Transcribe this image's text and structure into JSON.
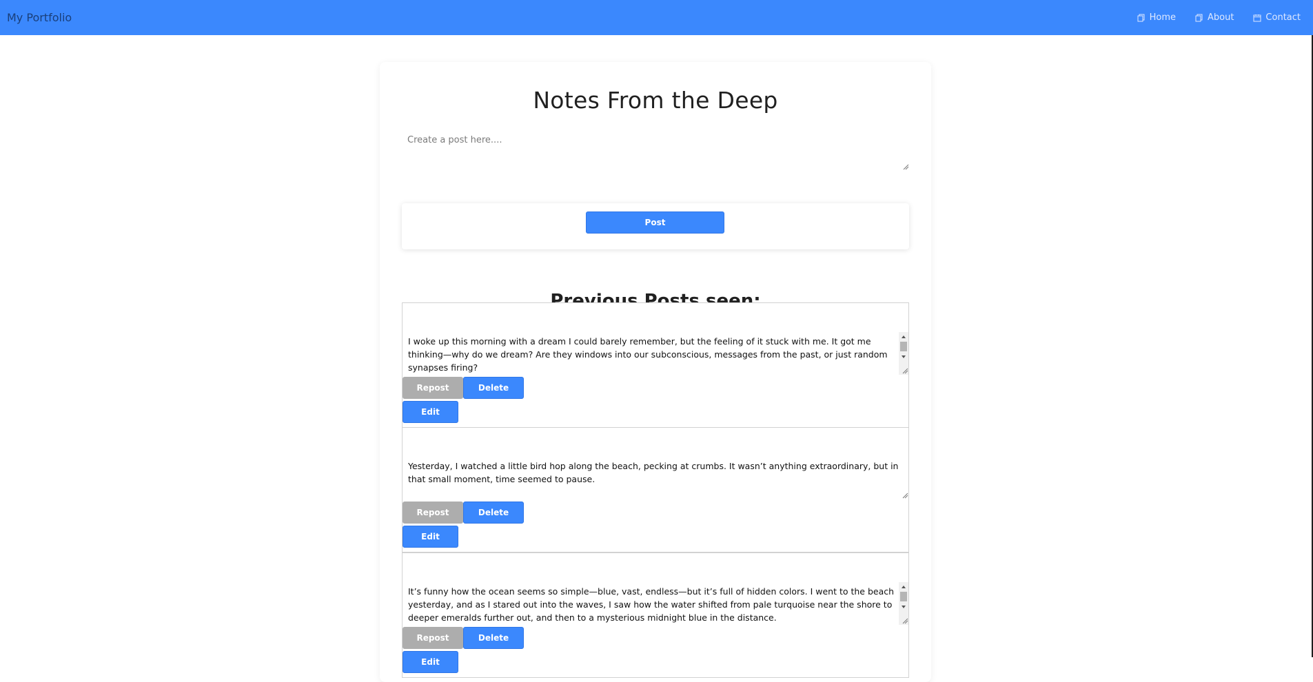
{
  "nav": {
    "brand": "My Portfolio",
    "links": [
      {
        "label": "Home",
        "icon": "copy-icon"
      },
      {
        "label": "About",
        "icon": "copy-icon"
      },
      {
        "label": "Contact",
        "icon": "calendar-icon"
      }
    ]
  },
  "main": {
    "title": "Notes From the Deep",
    "create_placeholder": "Create a post here....",
    "post_label": "Post",
    "previous_heading": "Previous Posts seen:"
  },
  "posts": [
    {
      "text": "I woke up this morning with a dream I could barely remember, but the feeling of it stuck with me. It got me thinking—why do we dream? Are they windows into our subconscious, messages from the past, or just random synapses firing?",
      "repost_label": "Repost",
      "delete_label": "Delete",
      "edit_label": "Edit"
    },
    {
      "text": "Yesterday, I watched a little bird hop along the beach, pecking at crumbs. It wasn’t anything extraordinary, but in that small moment, time seemed to pause.",
      "repost_label": "Repost",
      "delete_label": "Delete",
      "edit_label": "Edit"
    },
    {
      "text": "It’s funny how the ocean seems so simple—blue, vast, endless—but it’s full of hidden colors. I went to the beach yesterday, and as I stared out into the waves, I saw how the water shifted from pale turquoise near the shore to deeper emeralds further out, and then to a mysterious midnight blue in the distance.",
      "repost_label": "Repost",
      "delete_label": "Delete",
      "edit_label": "Edit"
    }
  ],
  "colors": {
    "accent": "#3b88fd",
    "repost": "#adadad"
  }
}
